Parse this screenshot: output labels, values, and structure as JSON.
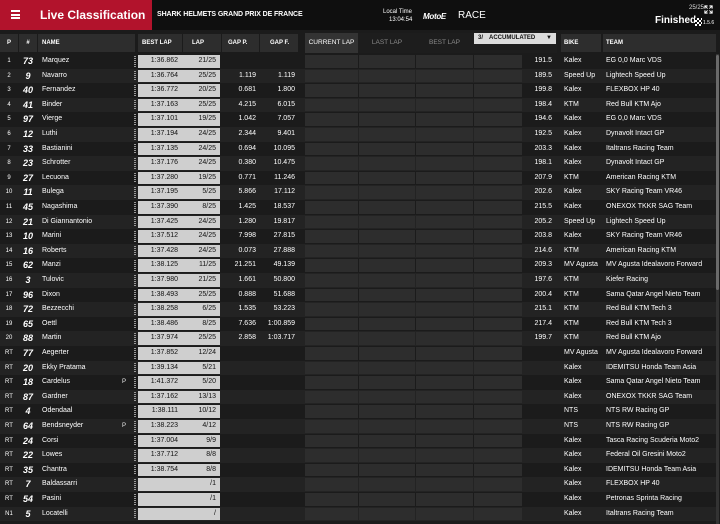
{
  "header": {
    "title": "Live Classification",
    "event": "SHARK HELMETS GRAND PRIX DE FRANCE",
    "local_time_label": "Local Time",
    "local_time": "13:04:54",
    "category_logo": "MotoE",
    "session": "RACE",
    "laps": "25/25",
    "status": "Finished",
    "flag_time": "1.5.6"
  },
  "columns": {
    "pos": "P",
    "num": "#",
    "name": "NAME",
    "best_lap": "BEST LAP",
    "lap": "LAP",
    "gap_p": "GAP P.",
    "gap_f": "GAP F.",
    "speed": "",
    "bike": "BIKE",
    "team": "TEAM"
  },
  "tabs": {
    "current": "CURRENT LAP",
    "last": "LAST LAP",
    "best": "BEST LAP"
  },
  "accumulated": {
    "symbol": "3/",
    "label": "ACCUMULATED"
  },
  "rows": [
    {
      "pos": "1",
      "num": "73",
      "name": "Marquez",
      "best": "1:36.862",
      "lap": "21/25",
      "gap_p": "",
      "gap_f": "",
      "speed": "191.5",
      "bike": "Kalex",
      "team": "EG 0,0 Marc VDS",
      "penalty": ""
    },
    {
      "pos": "2",
      "num": "9",
      "name": "Navarro",
      "best": "1:36.764",
      "lap": "25/25",
      "gap_p": "1.119",
      "gap_f": "1.119",
      "speed": "189.5",
      "bike": "Speed Up",
      "team": "Lightech Speed Up",
      "penalty": ""
    },
    {
      "pos": "3",
      "num": "40",
      "name": "Fernandez",
      "best": "1:36.772",
      "lap": "20/25",
      "gap_p": "0.681",
      "gap_f": "1.800",
      "speed": "199.8",
      "bike": "Kalex",
      "team": "FLEXBOX HP 40",
      "penalty": ""
    },
    {
      "pos": "4",
      "num": "41",
      "name": "Binder",
      "best": "1:37.163",
      "lap": "25/25",
      "gap_p": "4.215",
      "gap_f": "6.015",
      "speed": "198.4",
      "bike": "KTM",
      "team": "Red Bull KTM Ajo",
      "penalty": ""
    },
    {
      "pos": "5",
      "num": "97",
      "name": "Vierge",
      "best": "1:37.101",
      "lap": "19/25",
      "gap_p": "1.042",
      "gap_f": "7.057",
      "speed": "194.6",
      "bike": "Kalex",
      "team": "EG 0,0 Marc VDS",
      "penalty": ""
    },
    {
      "pos": "6",
      "num": "12",
      "name": "Luthi",
      "best": "1:37.194",
      "lap": "24/25",
      "gap_p": "2.344",
      "gap_f": "9.401",
      "speed": "192.5",
      "bike": "Kalex",
      "team": "Dynavolt Intact GP",
      "penalty": ""
    },
    {
      "pos": "7",
      "num": "33",
      "name": "Bastianini",
      "best": "1:37.135",
      "lap": "24/25",
      "gap_p": "0.694",
      "gap_f": "10.095",
      "speed": "203.3",
      "bike": "Kalex",
      "team": "Italtrans Racing Team",
      "penalty": ""
    },
    {
      "pos": "8",
      "num": "23",
      "name": "Schrotter",
      "best": "1:37.176",
      "lap": "24/25",
      "gap_p": "0.380",
      "gap_f": "10.475",
      "speed": "198.1",
      "bike": "Kalex",
      "team": "Dynavolt Intact GP",
      "penalty": ""
    },
    {
      "pos": "9",
      "num": "27",
      "name": "Lecuona",
      "best": "1:37.280",
      "lap": "19/25",
      "gap_p": "0.771",
      "gap_f": "11.246",
      "speed": "207.9",
      "bike": "KTM",
      "team": "American Racing KTM",
      "penalty": ""
    },
    {
      "pos": "10",
      "num": "11",
      "name": "Bulega",
      "best": "1:37.195",
      "lap": "5/25",
      "gap_p": "5.866",
      "gap_f": "17.112",
      "speed": "202.6",
      "bike": "Kalex",
      "team": "SKY Racing Team VR46",
      "penalty": ""
    },
    {
      "pos": "11",
      "num": "45",
      "name": "Nagashima",
      "best": "1:37.390",
      "lap": "8/25",
      "gap_p": "1.425",
      "gap_f": "18.537",
      "speed": "215.5",
      "bike": "Kalex",
      "team": "ONEXOX TKKR SAG Team",
      "penalty": ""
    },
    {
      "pos": "12",
      "num": "21",
      "name": "Di Giannantonio",
      "best": "1:37.425",
      "lap": "24/25",
      "gap_p": "1.280",
      "gap_f": "19.817",
      "speed": "205.2",
      "bike": "Speed Up",
      "team": "Lightech Speed Up",
      "penalty": ""
    },
    {
      "pos": "13",
      "num": "10",
      "name": "Marini",
      "best": "1:37.512",
      "lap": "24/25",
      "gap_p": "7.998",
      "gap_f": "27.815",
      "speed": "203.8",
      "bike": "Kalex",
      "team": "SKY Racing Team VR46",
      "penalty": ""
    },
    {
      "pos": "14",
      "num": "16",
      "name": "Roberts",
      "best": "1:37.428",
      "lap": "24/25",
      "gap_p": "0.073",
      "gap_f": "27.888",
      "speed": "214.6",
      "bike": "KTM",
      "team": "American Racing KTM",
      "penalty": ""
    },
    {
      "pos": "15",
      "num": "62",
      "name": "Manzi",
      "best": "1:38.125",
      "lap": "11/25",
      "gap_p": "21.251",
      "gap_f": "49.139",
      "speed": "209.3",
      "bike": "MV Agusta",
      "team": "MV Agusta Idealavoro Forward",
      "penalty": ""
    },
    {
      "pos": "16",
      "num": "3",
      "name": "Tulovic",
      "best": "1:37.980",
      "lap": "21/25",
      "gap_p": "1.661",
      "gap_f": "50.800",
      "speed": "197.6",
      "bike": "KTM",
      "team": "Kiefer Racing",
      "penalty": ""
    },
    {
      "pos": "17",
      "num": "96",
      "name": "Dixon",
      "best": "1:38.493",
      "lap": "25/25",
      "gap_p": "0.888",
      "gap_f": "51.688",
      "speed": "200.4",
      "bike": "KTM",
      "team": "Sama Qatar Angel Nieto Team",
      "penalty": ""
    },
    {
      "pos": "18",
      "num": "72",
      "name": "Bezzecchi",
      "best": "1:38.258",
      "lap": "6/25",
      "gap_p": "1.535",
      "gap_f": "53.223",
      "speed": "215.1",
      "bike": "KTM",
      "team": "Red Bull KTM Tech 3",
      "penalty": ""
    },
    {
      "pos": "19",
      "num": "65",
      "name": "Oettl",
      "best": "1:38.486",
      "lap": "8/25",
      "gap_p": "7.636",
      "gap_f": "1:00.859",
      "speed": "217.4",
      "bike": "KTM",
      "team": "Red Bull KTM Tech 3",
      "penalty": ""
    },
    {
      "pos": "20",
      "num": "88",
      "name": "Martin",
      "best": "1:37.974",
      "lap": "25/25",
      "gap_p": "2.858",
      "gap_f": "1:03.717",
      "speed": "199.7",
      "bike": "KTM",
      "team": "Red Bull KTM Ajo",
      "penalty": ""
    },
    {
      "pos": "RT",
      "num": "77",
      "name": "Aegerter",
      "best": "1:37.852",
      "lap": "12/24",
      "gap_p": "",
      "gap_f": "",
      "speed": "",
      "bike": "MV Agusta",
      "team": "MV Agusta Idealavoro Forward",
      "penalty": ""
    },
    {
      "pos": "RT",
      "num": "20",
      "name": "Ekky Pratama",
      "best": "1:39.134",
      "lap": "5/21",
      "gap_p": "",
      "gap_f": "",
      "speed": "",
      "bike": "Kalex",
      "team": "IDEMITSU Honda Team Asia",
      "penalty": ""
    },
    {
      "pos": "RT",
      "num": "18",
      "name": "Cardelus",
      "best": "1:41.372",
      "lap": "5/20",
      "gap_p": "",
      "gap_f": "",
      "speed": "",
      "bike": "Kalex",
      "team": "Sama Qatar Angel Nieto Team",
      "penalty": "P"
    },
    {
      "pos": "RT",
      "num": "87",
      "name": "Gardner",
      "best": "1:37.162",
      "lap": "13/13",
      "gap_p": "",
      "gap_f": "",
      "speed": "",
      "bike": "Kalex",
      "team": "ONEXOX TKKR SAG Team",
      "penalty": ""
    },
    {
      "pos": "RT",
      "num": "4",
      "name": "Odendaal",
      "best": "1:38.111",
      "lap": "10/12",
      "gap_p": "",
      "gap_f": "",
      "speed": "",
      "bike": "NTS",
      "team": "NTS RW Racing GP",
      "penalty": ""
    },
    {
      "pos": "RT",
      "num": "64",
      "name": "Bendsneyder",
      "best": "1:38.223",
      "lap": "4/12",
      "gap_p": "",
      "gap_f": "",
      "speed": "",
      "bike": "NTS",
      "team": "NTS RW Racing GP",
      "penalty": "P"
    },
    {
      "pos": "RT",
      "num": "24",
      "name": "Corsi",
      "best": "1:37.004",
      "lap": "9/9",
      "gap_p": "",
      "gap_f": "",
      "speed": "",
      "bike": "Kalex",
      "team": "Tasca Racing Scuderia Moto2",
      "penalty": ""
    },
    {
      "pos": "RT",
      "num": "22",
      "name": "Lowes",
      "best": "1:37.712",
      "lap": "8/8",
      "gap_p": "",
      "gap_f": "",
      "speed": "",
      "bike": "Kalex",
      "team": "Federal Oil Gresini Moto2",
      "penalty": ""
    },
    {
      "pos": "RT",
      "num": "35",
      "name": "Chantra",
      "best": "1:38.754",
      "lap": "8/8",
      "gap_p": "",
      "gap_f": "",
      "speed": "",
      "bike": "Kalex",
      "team": "IDEMITSU Honda Team Asia",
      "penalty": ""
    },
    {
      "pos": "RT",
      "num": "7",
      "name": "Baldassarri",
      "best": "",
      "lap": "/1",
      "gap_p": "",
      "gap_f": "",
      "speed": "",
      "bike": "Kalex",
      "team": "FLEXBOX HP 40",
      "penalty": ""
    },
    {
      "pos": "RT",
      "num": "54",
      "name": "Pasini",
      "best": "",
      "lap": "/1",
      "gap_p": "",
      "gap_f": "",
      "speed": "",
      "bike": "Kalex",
      "team": "Petronas Sprinta Racing",
      "penalty": ""
    },
    {
      "pos": "N1",
      "num": "5",
      "name": "Locatelli",
      "best": "",
      "lap": "/",
      "gap_p": "",
      "gap_f": "",
      "speed": "",
      "bike": "Kalex",
      "team": "Italtrans Racing Team",
      "penalty": ""
    }
  ],
  "colors": {
    "accent": "#b2132c",
    "row_dark": "#1b1b1b",
    "row_light": "#242424",
    "cell_highlight": "#cfcfcf"
  }
}
